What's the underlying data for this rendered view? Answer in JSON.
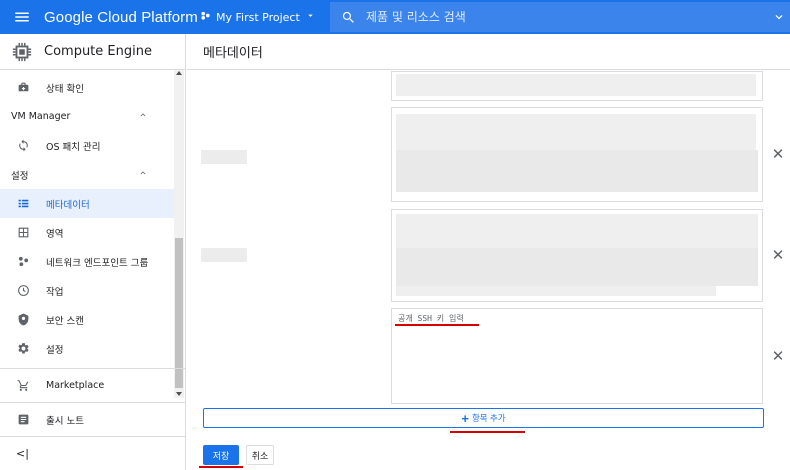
{
  "topbar": {
    "brand": "Google Cloud Platform",
    "project": "My First Project",
    "search_placeholder": "제품 및 리소스 검색",
    "accent": "#1a73e8"
  },
  "sidebar": {
    "product": "Compute Engine",
    "items_top": [
      {
        "label": "상태 확인",
        "icon": "health-check-icon"
      }
    ],
    "group_vm": {
      "label": "VM Manager",
      "items": [
        {
          "label": "OS 패치 관리",
          "icon": "patch-icon"
        }
      ]
    },
    "group_settings": {
      "label": "설정",
      "items": [
        {
          "label": "메타데이터",
          "icon": "list-icon",
          "active": true
        },
        {
          "label": "영역",
          "icon": "zones-icon"
        },
        {
          "label": "네트워크 엔드포인트 그룹",
          "icon": "network-icon"
        },
        {
          "label": "작업",
          "icon": "clock-icon"
        },
        {
          "label": "보안 스캔",
          "icon": "shield-icon"
        },
        {
          "label": "설정",
          "icon": "gear-icon"
        }
      ]
    },
    "marketplace": "Marketplace",
    "release_notes": "출시 노트",
    "collapse": "<|"
  },
  "main": {
    "title": "메타데이터",
    "ssh_placeholder": "공개 SSH 키 입력",
    "add_item": "항목 추가",
    "save": "저장",
    "cancel": "취소"
  }
}
